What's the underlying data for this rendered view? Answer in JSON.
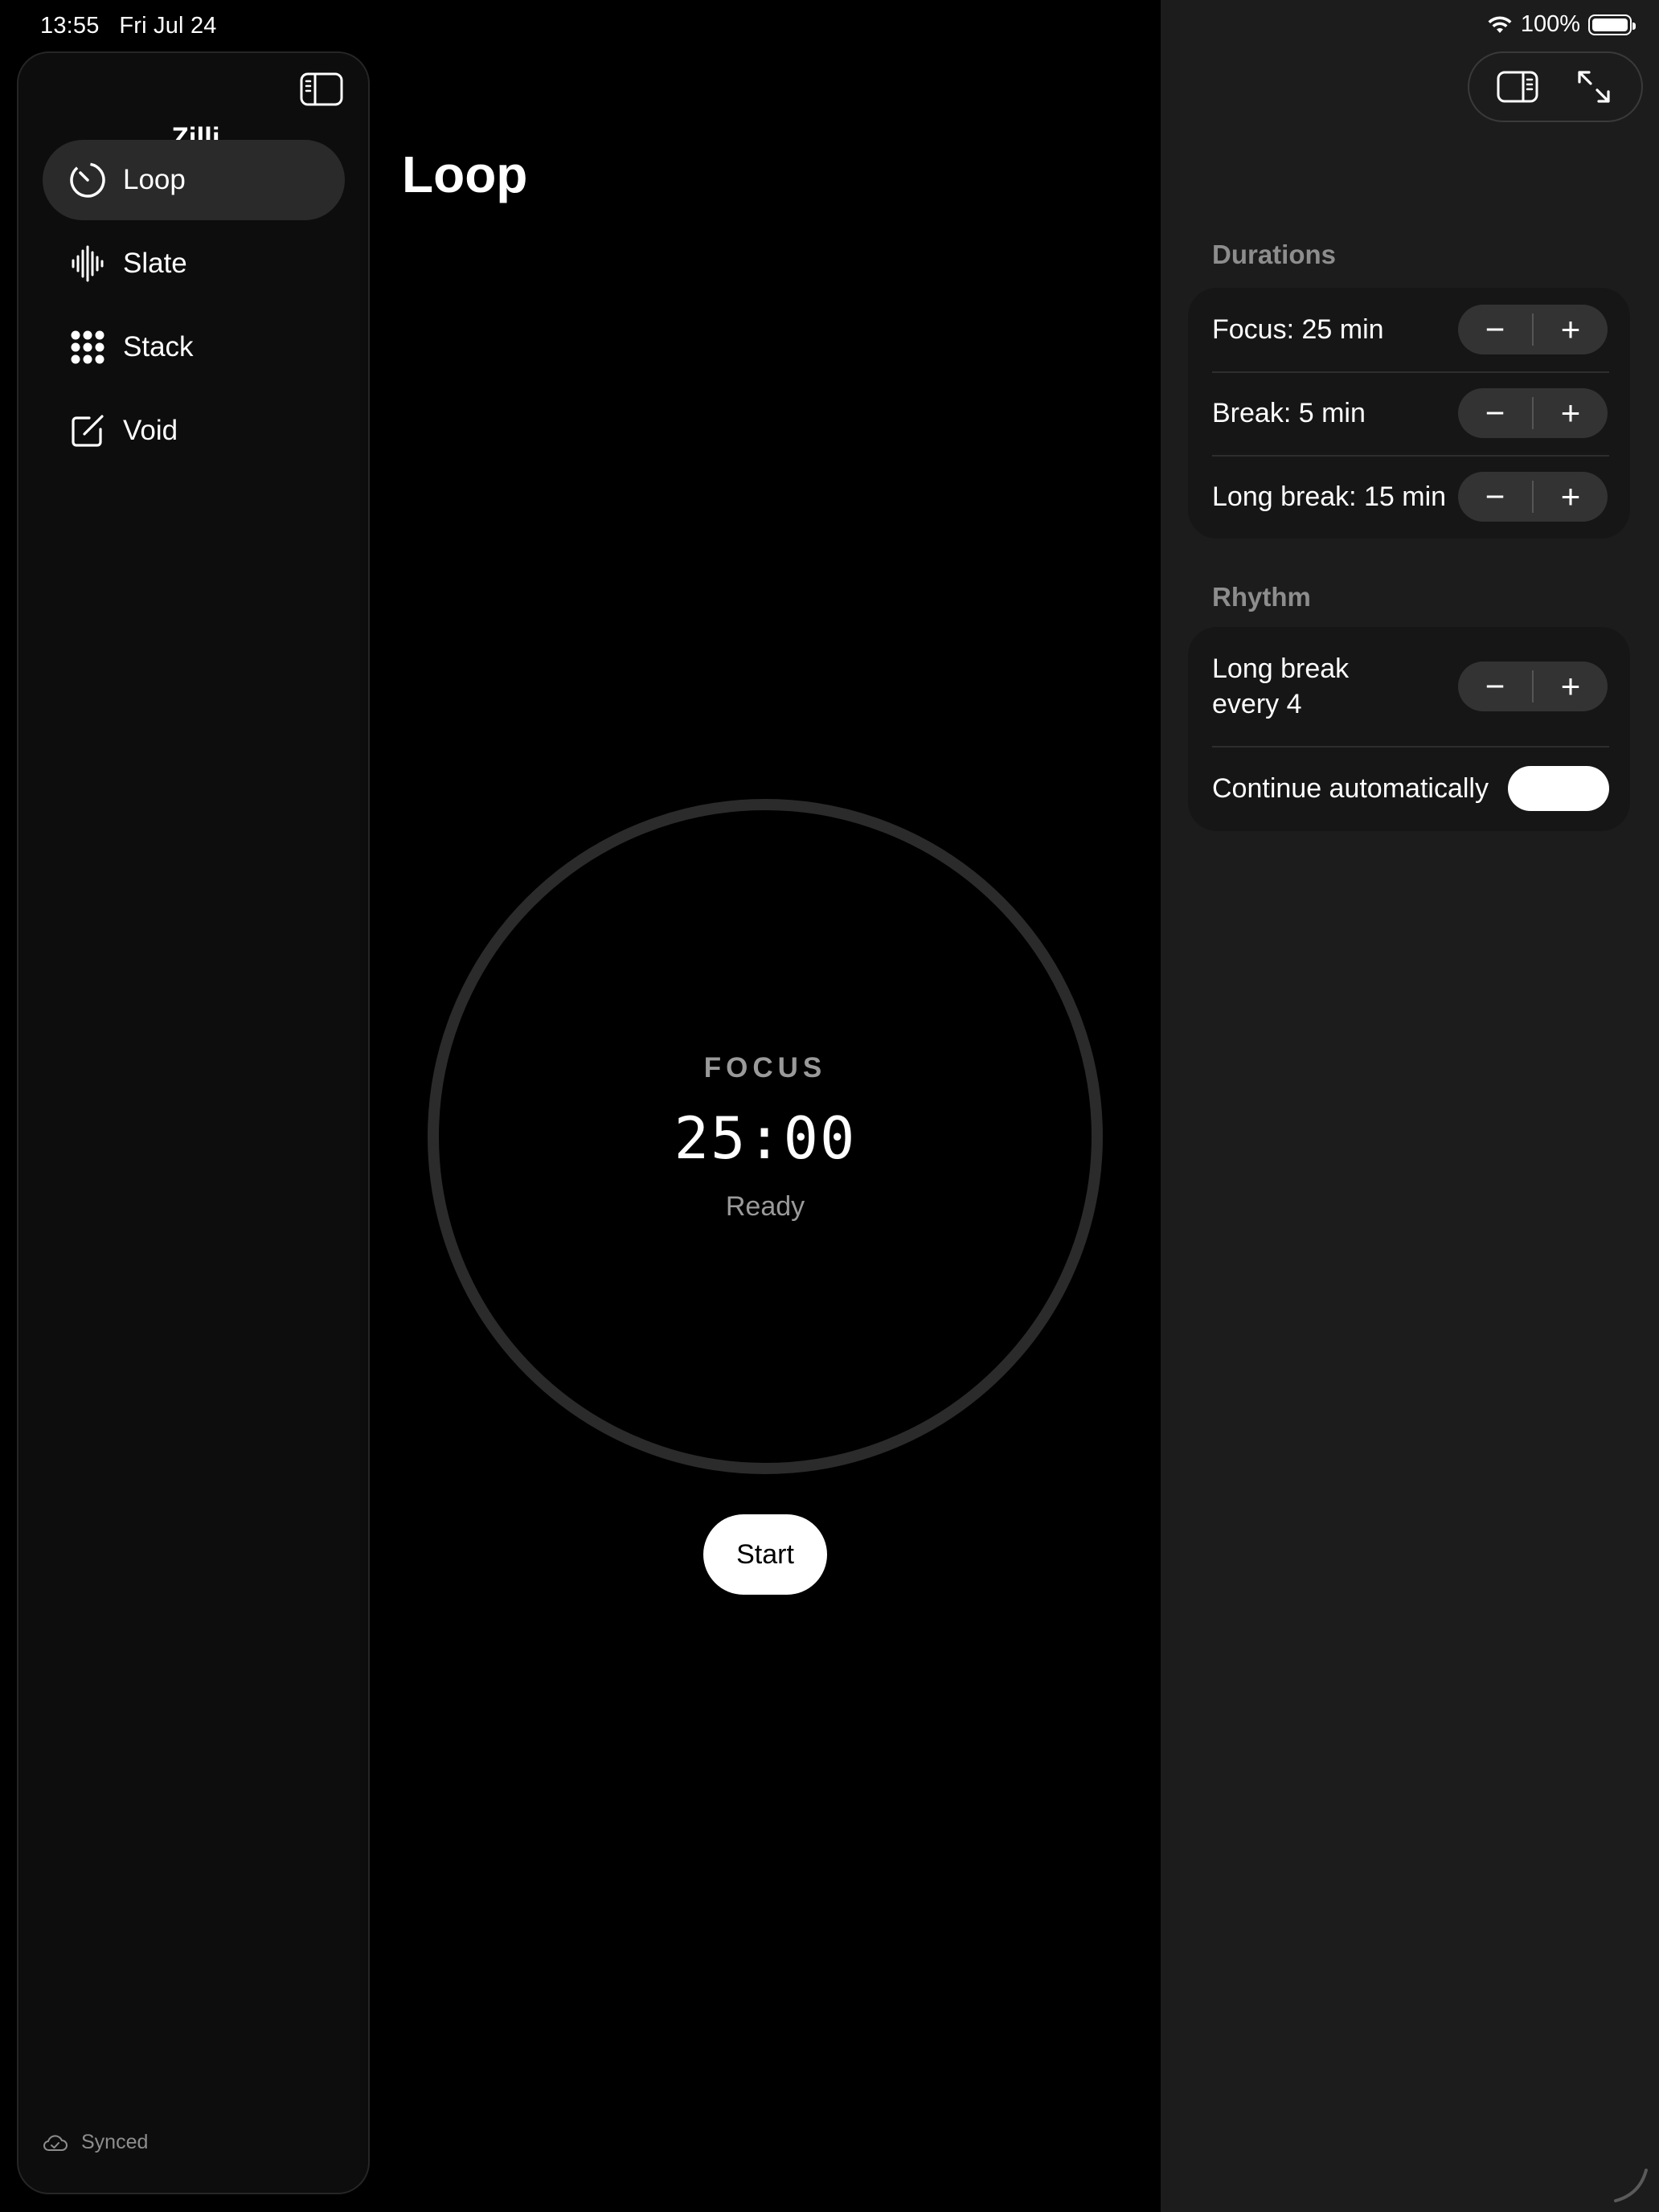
{
  "status_bar": {
    "time": "13:55",
    "date": "Fri Jul 24",
    "battery": "100%"
  },
  "sidebar": {
    "title": "Zilli",
    "items": [
      {
        "label": "Loop",
        "icon": "timer-icon",
        "active": true
      },
      {
        "label": "Slate",
        "icon": "waveform-icon",
        "active": false
      },
      {
        "label": "Stack",
        "icon": "grid-icon",
        "active": false
      },
      {
        "label": "Void",
        "icon": "compose-icon",
        "active": false
      }
    ],
    "sync_status": "Synced"
  },
  "main": {
    "title": "Loop",
    "timer": {
      "mode": "FOCUS",
      "time": "25:00",
      "status": "Ready",
      "progress": 0
    },
    "start_label": "Start"
  },
  "inspector": {
    "durations_header": "Durations",
    "durations": [
      {
        "label": "Focus: 25 min"
      },
      {
        "label": "Break: 5 min"
      },
      {
        "label": "Long break: 15 min"
      }
    ],
    "rhythm_header": "Rhythm",
    "long_break_every_line1": "Long break",
    "long_break_every_line2": "every 4",
    "continue_label": "Continue automatically",
    "continue_on": true,
    "stepper_minus": "−",
    "stepper_plus": "+"
  },
  "colors": {
    "background": "#000000",
    "sidebar": "#0d0d0d",
    "inspector": "#1c1c1c",
    "ring": "#2b2b2b",
    "secondary_text": "#9a9a9a"
  }
}
